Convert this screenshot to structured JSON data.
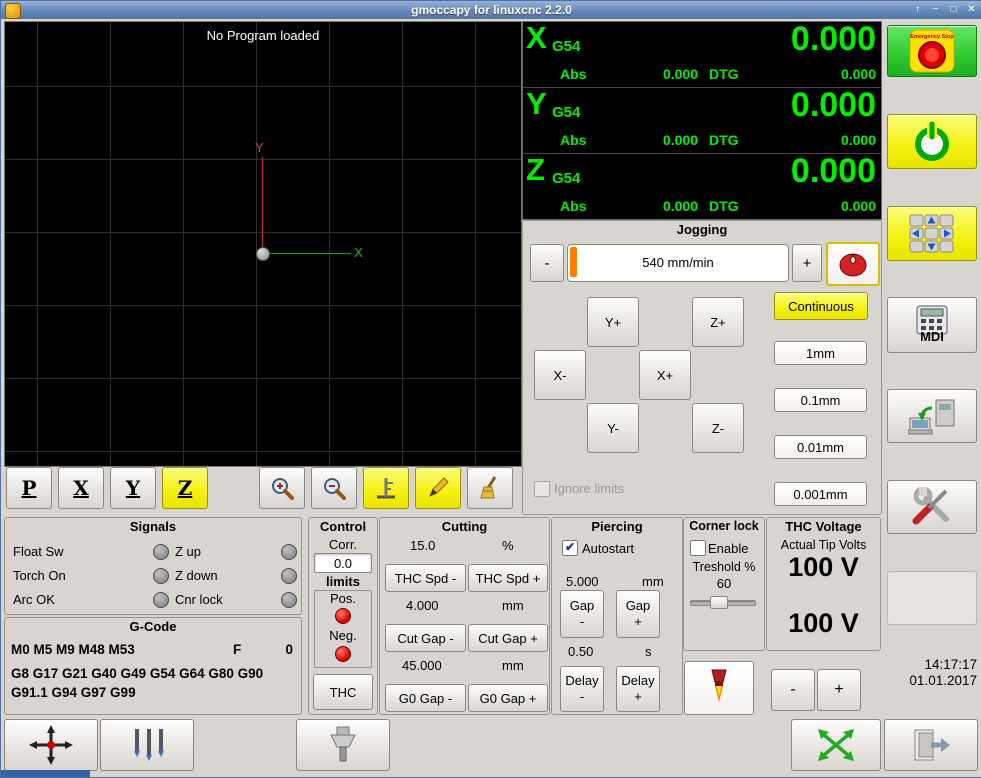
{
  "window": {
    "title": "gmoccapy for linuxcnc  2.2.0",
    "controls": {
      "shade": "↑",
      "minimize": "−",
      "maximize": "□",
      "close": "✕"
    }
  },
  "preview": {
    "message": "No Program loaded",
    "x_axis_label": "X",
    "y_axis_label": "Y"
  },
  "preview_toolbar": {
    "letter_p": "P",
    "letter_x": "X",
    "letter_y": "Y",
    "letter_z": "Z"
  },
  "dro": {
    "abs_label": "Abs",
    "dtg_label": "DTG",
    "axes": [
      {
        "letter": "X",
        "system": "G54",
        "value": "0.000",
        "abs": "0.000",
        "dtg": "0.000"
      },
      {
        "letter": "Y",
        "system": "G54",
        "value": "0.000",
        "abs": "0.000",
        "dtg": "0.000"
      },
      {
        "letter": "Z",
        "system": "G54",
        "value": "0.000",
        "abs": "0.000",
        "dtg": "0.000"
      }
    ]
  },
  "jog": {
    "title": "Jogging",
    "speed": "540 mm/min",
    "dec": "-",
    "inc": "+",
    "continuous": "Continuous",
    "buttons": {
      "y_plus": "Y+",
      "z_plus": "Z+",
      "x_minus": "X-",
      "x_plus": "X+",
      "y_minus": "Y-",
      "z_minus": "Z-"
    },
    "increments": [
      "1mm",
      "0.1mm",
      "0.01mm",
      "0.001mm"
    ],
    "ignore_limits": "Ignore limits"
  },
  "signals": {
    "title": "Signals",
    "left": [
      "Float Sw",
      "Torch On",
      "Arc OK"
    ],
    "right": [
      "Z up",
      "Z down",
      "Cnr lock"
    ]
  },
  "gcode": {
    "title": "G-Code",
    "m_codes": "M0 M5 M9 M48 M53",
    "f_label": "F",
    "f_value": "0",
    "g_codes": "G8 G17 G21 G40 G49 G54 G64 G80 G90 G91.1 G94 G97 G99"
  },
  "control": {
    "title": "Control",
    "corr_label": "Corr.",
    "corr_value": "0.0",
    "limits_label": "limits",
    "pos_label": "Pos.",
    "neg_label": "Neg.",
    "thc_button": "THC"
  },
  "cutting": {
    "title": "Cutting",
    "feed_value": "15.0",
    "feed_unit": "%",
    "thc_spd_dec": "THC Spd -",
    "thc_spd_inc": "THC Spd +",
    "cut_gap_value": "4.000",
    "cut_gap_unit": "mm",
    "cut_gap_dec": "Cut Gap -",
    "cut_gap_inc": "Cut Gap +",
    "g0_gap_value": "45.000",
    "g0_gap_unit": "mm",
    "g0_gap_dec": "G0 Gap -",
    "g0_gap_inc": "G0 Gap +"
  },
  "piercing": {
    "title": "Piercing",
    "autostart": "Autostart",
    "height_value": "5.000",
    "height_unit": "mm",
    "gap_label": "Gap",
    "delay_label": "Delay",
    "dec": "-",
    "inc": "+",
    "delay_value": "0.50",
    "delay_unit": "s"
  },
  "corner_lock": {
    "title": "Corner lock",
    "enable": "Enable",
    "threshold_label": "Treshold %",
    "threshold_value": "60"
  },
  "thc_voltage": {
    "title": "THC Voltage",
    "subtitle": "Actual Tip Volts",
    "actual_volts": "100 V",
    "set_volts": "100 V",
    "dec": "-",
    "inc": "+"
  },
  "clock": {
    "time": "14:17:17",
    "date": "01.01.2017"
  },
  "side_buttons": {
    "mdi_label": "MDI"
  },
  "colors": {
    "dro_green": "#00f000",
    "accent_yellow": "#f4f111",
    "estop_green": "#2ec82e",
    "led_red": "#d40000",
    "led_off": "#8a8a8a",
    "titlebar_blue": "#6285b6",
    "jog_fill_orange": "#ff8000"
  },
  "icons": {
    "emergency-stop-icon": "red-mushroom-on-yellow",
    "power-icon": "⏻",
    "jog-pad-icon": "arrow-keypad",
    "mdi-icon": "calculator",
    "machine-setup-icon": "computer-and-machine",
    "tools-icon": "wrench-and-screwdriver",
    "mouse-jog-icon": "red-mouse",
    "zoom-in-icon": "magnifier-plus",
    "zoom-out-icon": "magnifier-minus",
    "tool-measure-icon": "height-gauge",
    "edit-pencil-icon": "✏",
    "clear-plot-icon": "broom",
    "torch-icon": "torch-flame",
    "move-origin-icon": "axes-cross-red-dot",
    "probe-icon": "probe-pins",
    "tool-holder-icon": "spindle-tool",
    "fullscreen-icon": "green-expand-arrows",
    "exit-icon": "door-with-arrow"
  }
}
